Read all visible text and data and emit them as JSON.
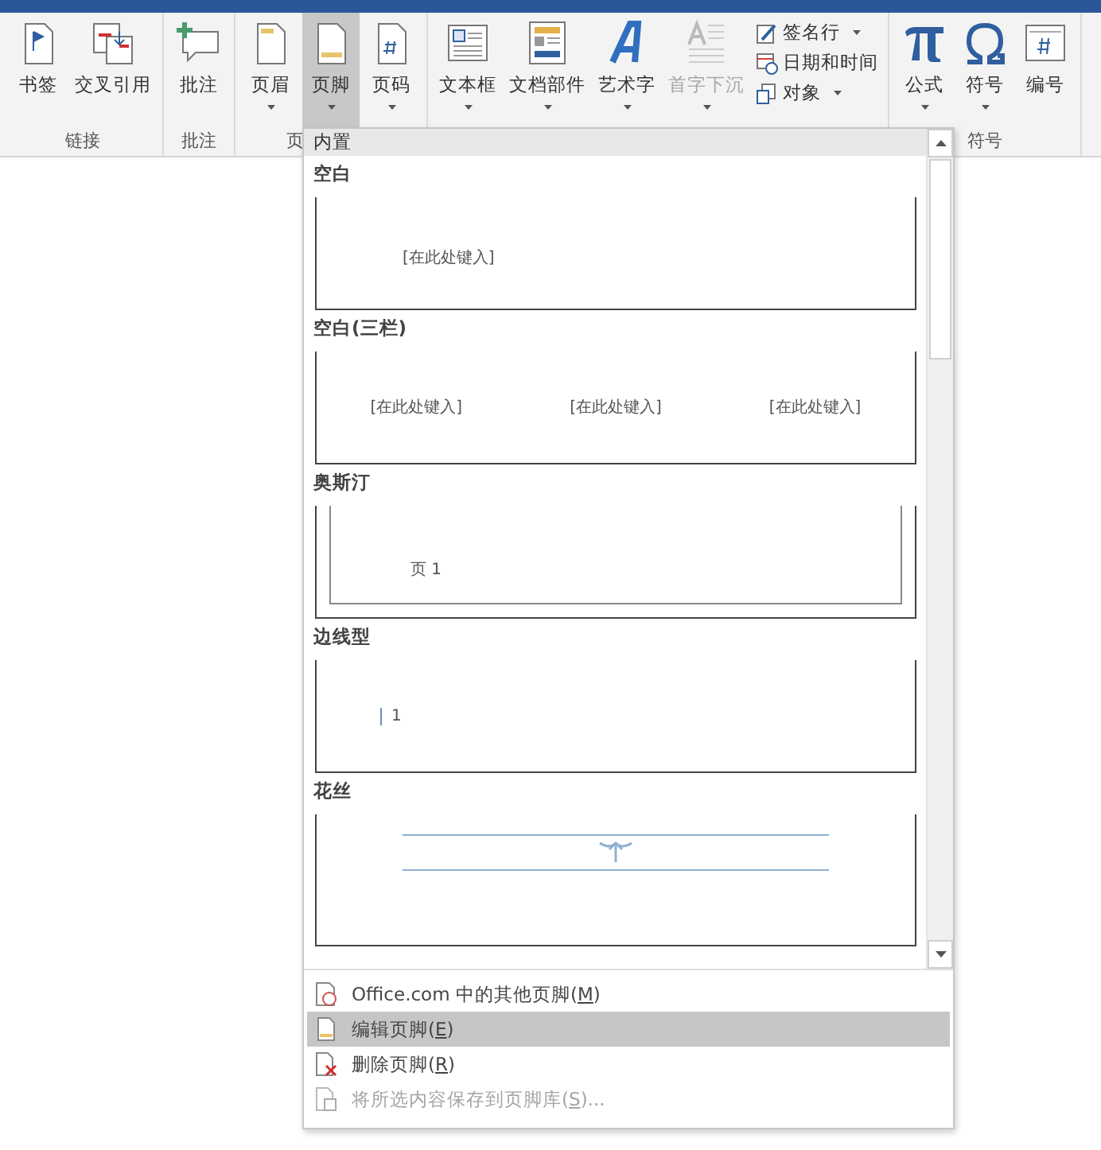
{
  "ribbon": {
    "groups": [
      {
        "label": "链接",
        "buttons": [
          {
            "label": "书签",
            "kind": "bookmark",
            "has_menu": false,
            "selected": false,
            "disabled": false
          },
          {
            "label": "交叉引用",
            "kind": "crossref",
            "has_menu": false,
            "selected": false,
            "disabled": false
          }
        ]
      },
      {
        "label": "批注",
        "buttons": [
          {
            "label": "批注",
            "kind": "comment",
            "has_menu": false,
            "selected": false,
            "disabled": false
          }
        ]
      },
      {
        "label": "页",
        "buttons": [
          {
            "label": "页眉",
            "kind": "header",
            "has_menu": true,
            "selected": false,
            "disabled": false
          },
          {
            "label": "页脚",
            "kind": "footer",
            "has_menu": true,
            "selected": true,
            "disabled": false
          },
          {
            "label": "页码",
            "kind": "pagenumber",
            "has_menu": true,
            "selected": false,
            "disabled": false
          }
        ]
      },
      {
        "buttons": [
          {
            "label": "文本框",
            "kind": "textbox",
            "has_menu": true,
            "selected": false,
            "disabled": false
          },
          {
            "label": "文档部件",
            "kind": "quickparts",
            "has_menu": true,
            "selected": false,
            "disabled": false
          },
          {
            "label": "艺术字",
            "kind": "wordart",
            "has_menu": true,
            "selected": false,
            "disabled": false
          },
          {
            "label": "首字下沉",
            "kind": "dropcap",
            "has_menu": true,
            "selected": false,
            "disabled": true
          }
        ],
        "small_buttons": [
          {
            "label": "签名行",
            "kind": "signature",
            "has_menu": true
          },
          {
            "label": "日期和时间",
            "kind": "datetime",
            "has_menu": false
          },
          {
            "label": "对象",
            "kind": "object",
            "has_menu": true
          }
        ]
      },
      {
        "label": "符号",
        "buttons": [
          {
            "label": "公式",
            "kind": "formula",
            "has_menu": true,
            "selected": false,
            "disabled": false
          },
          {
            "label": "符号",
            "kind": "symbol",
            "has_menu": true,
            "selected": false,
            "disabled": false
          },
          {
            "label": "编号",
            "kind": "numbering",
            "has_menu": false,
            "selected": false,
            "disabled": false
          }
        ]
      }
    ]
  },
  "footer_menu": {
    "section": "内置",
    "gallery": [
      {
        "label": "空白",
        "kind": "blank",
        "texts": [
          "[在此处键入]"
        ]
      },
      {
        "label": "空白(三栏)",
        "kind": "three_column",
        "texts": [
          "[在此处键入]",
          "[在此处键入]",
          "[在此处键入]"
        ]
      },
      {
        "label": "奥斯汀",
        "kind": "austin",
        "texts": [
          "页 1"
        ]
      },
      {
        "label": "边线型",
        "kind": "sideline",
        "texts": [
          "1"
        ]
      },
      {
        "label": "花丝",
        "kind": "filigree"
      }
    ],
    "items": [
      {
        "parts": [
          "Office.com 中的其他页脚(",
          "M",
          ")"
        ],
        "kind": "office",
        "selected": false,
        "disabled": false
      },
      {
        "parts": [
          "编辑页脚(",
          "E",
          ")"
        ],
        "kind": "edit",
        "selected": true,
        "disabled": false
      },
      {
        "parts": [
          "删除页脚(",
          "R",
          ")"
        ],
        "kind": "remove",
        "selected": false,
        "disabled": false
      },
      {
        "parts": [
          "将所选内容保存到页脚库(",
          "S",
          ")..."
        ],
        "kind": "save",
        "selected": false,
        "disabled": true
      }
    ]
  }
}
